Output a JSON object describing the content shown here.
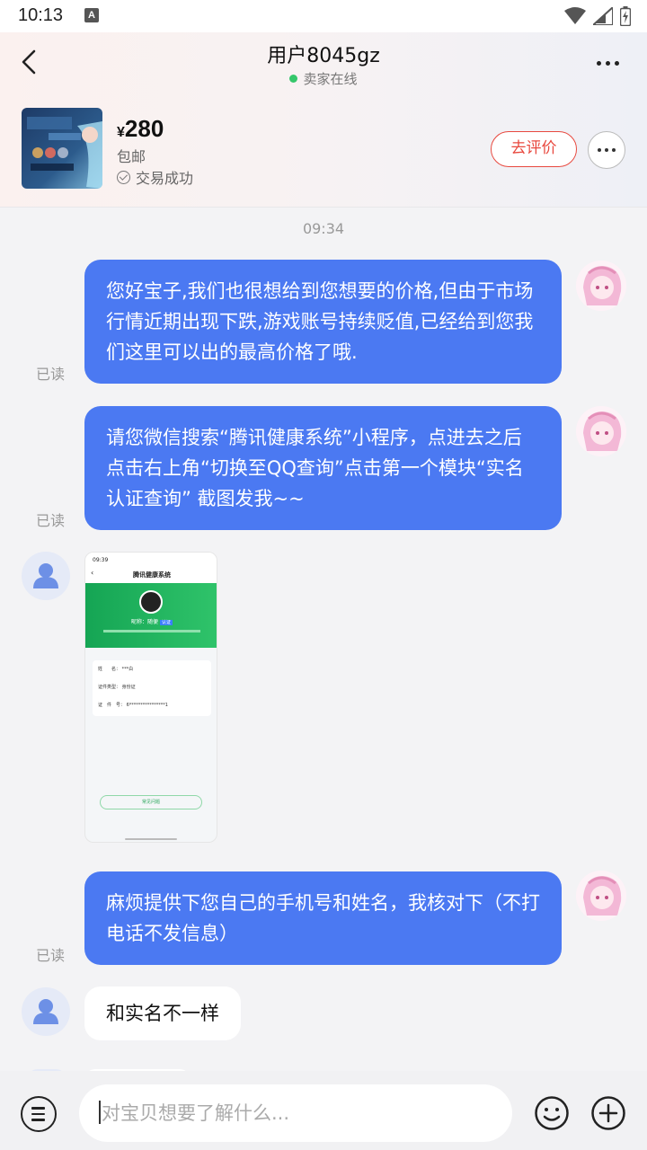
{
  "status_bar": {
    "time": "10:13",
    "notification_icon": "A"
  },
  "header": {
    "title": "用户8045gz",
    "subtitle": "卖家在线",
    "product": {
      "currency": "¥",
      "price": "280",
      "shipping": "包邮",
      "deal_status": "交易成功",
      "review_button": "去评价"
    }
  },
  "chat": {
    "timestamp": "09:34",
    "messages": [
      {
        "side": "out",
        "text": "您好宝子,我们也很想给到您想要的价格,但由于市场行情近期出现下跌,游戏账号持续贬值,已经给到您我们这里可以出的最高价格了哦.",
        "read": "已读"
      },
      {
        "side": "out",
        "text": "请您微信搜索“腾讯健康系统”小程序，点进去之后点击右上角“切换至QQ查询”点击第一个模块“实名认证查询” 截图发我~~",
        "read": "已读"
      },
      {
        "side": "in",
        "type": "image",
        "image_texts": {
          "time": "09:39",
          "app_title": "腾讯健康系统",
          "nickname_label": "昵称：",
          "nickname": "随便",
          "badge": "认证",
          "name_label": "姓　　名：",
          "name_value": "***白",
          "id_type_label": "证件类型：",
          "id_type_value": "身份证",
          "id_no_label": "证　件　号：",
          "id_no_value": "6****************1",
          "footer_button": "常见问题"
        }
      },
      {
        "side": "out",
        "text": "麻烦提供下您自己的手机号和姓名，我核对下（不打电话不发信息）",
        "read": "已读"
      },
      {
        "side": "in",
        "text": "和实名不一样"
      }
    ]
  },
  "input_bar": {
    "placeholder": "对宝贝想要了解什么..."
  },
  "icons": [
    "back-icon",
    "more-icon",
    "menu-icon",
    "emoji-icon",
    "plus-icon",
    "wifi-icon",
    "signal-icon",
    "battery-icon"
  ],
  "colors": {
    "bubble_out": "#4b79f2",
    "review_red": "#e8493f",
    "online_green": "#35c76b"
  }
}
